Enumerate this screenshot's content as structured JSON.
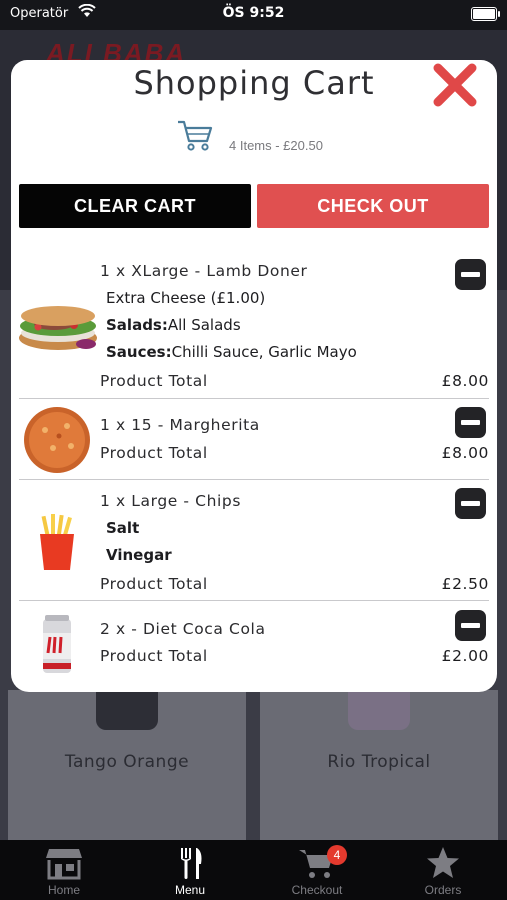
{
  "status_bar": {
    "carrier": "Operatör",
    "time": "ÖS 9:52"
  },
  "background": {
    "logo_text": "ALI BABA",
    "cards": [
      {
        "label": "Tango Orange"
      },
      {
        "label": "Rio Tropical"
      }
    ]
  },
  "cart": {
    "title": "Shopping Cart",
    "summary": "4 Items - £20.50",
    "clear_label": "CLEAR CART",
    "checkout_label": "CHECK OUT",
    "product_total_label": "Product Total",
    "items": [
      {
        "name": "1 x XLarge - Lamb Doner",
        "image": "doner-kebab",
        "options": [
          {
            "label": "",
            "value": "Extra Cheese (£1.00)"
          },
          {
            "label": "Salads:",
            "value": "All Salads"
          },
          {
            "label": "Sauces:",
            "value": "Chilli Sauce, Garlic Mayo"
          }
        ],
        "total": "£8.00"
      },
      {
        "name": "1 x 15 - Margherita",
        "image": "pizza",
        "options": [],
        "total": "£8.00"
      },
      {
        "name": "1 x Large - Chips",
        "image": "fries",
        "options": [
          {
            "label": "Salt",
            "value": ""
          },
          {
            "label": "Vinegar",
            "value": ""
          }
        ],
        "total": "£2.50"
      },
      {
        "name": "2 x - Diet Coca Cola",
        "image": "diet-coke-can",
        "options": [],
        "total": "£2.00"
      }
    ]
  },
  "tabbar": {
    "tabs": [
      {
        "label": "Home",
        "icon": "store-icon",
        "active": false
      },
      {
        "label": "Menu",
        "icon": "cutlery-icon",
        "active": true
      },
      {
        "label": "Checkout",
        "icon": "cart-icon",
        "active": false,
        "badge": "4"
      },
      {
        "label": "Orders",
        "icon": "star-icon",
        "active": false
      }
    ]
  },
  "colors": {
    "accent_red": "#e05050",
    "close_red": "#e04848",
    "badge_red": "#e43a2e",
    "dark": "#050505"
  }
}
